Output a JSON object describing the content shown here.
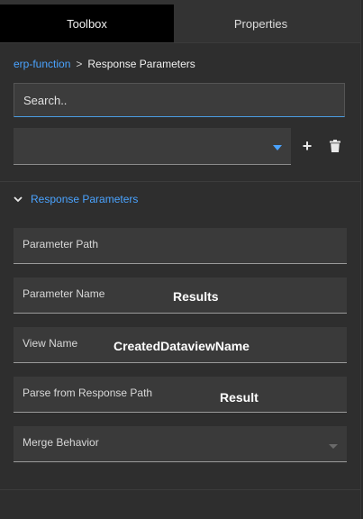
{
  "tabs": [
    {
      "label": "Toolbox"
    },
    {
      "label": "Properties"
    }
  ],
  "breadcrumb": {
    "parent": "erp-function",
    "separator": ">",
    "current": "Response Parameters"
  },
  "search": {
    "placeholder": "Search.."
  },
  "select": {
    "value": ""
  },
  "section": {
    "title": "Response Parameters"
  },
  "fields": [
    {
      "label": "Parameter Path",
      "value": ""
    },
    {
      "label": "Parameter Name",
      "value": "Results"
    },
    {
      "label": "View Name",
      "value": "CreatedDataviewName"
    },
    {
      "label": "Parse from Response Path",
      "value": "Result"
    },
    {
      "label": "Merge Behavior",
      "value": ""
    }
  ],
  "colors": {
    "accent": "#4aa3ff",
    "background": "#2e2e2e"
  }
}
